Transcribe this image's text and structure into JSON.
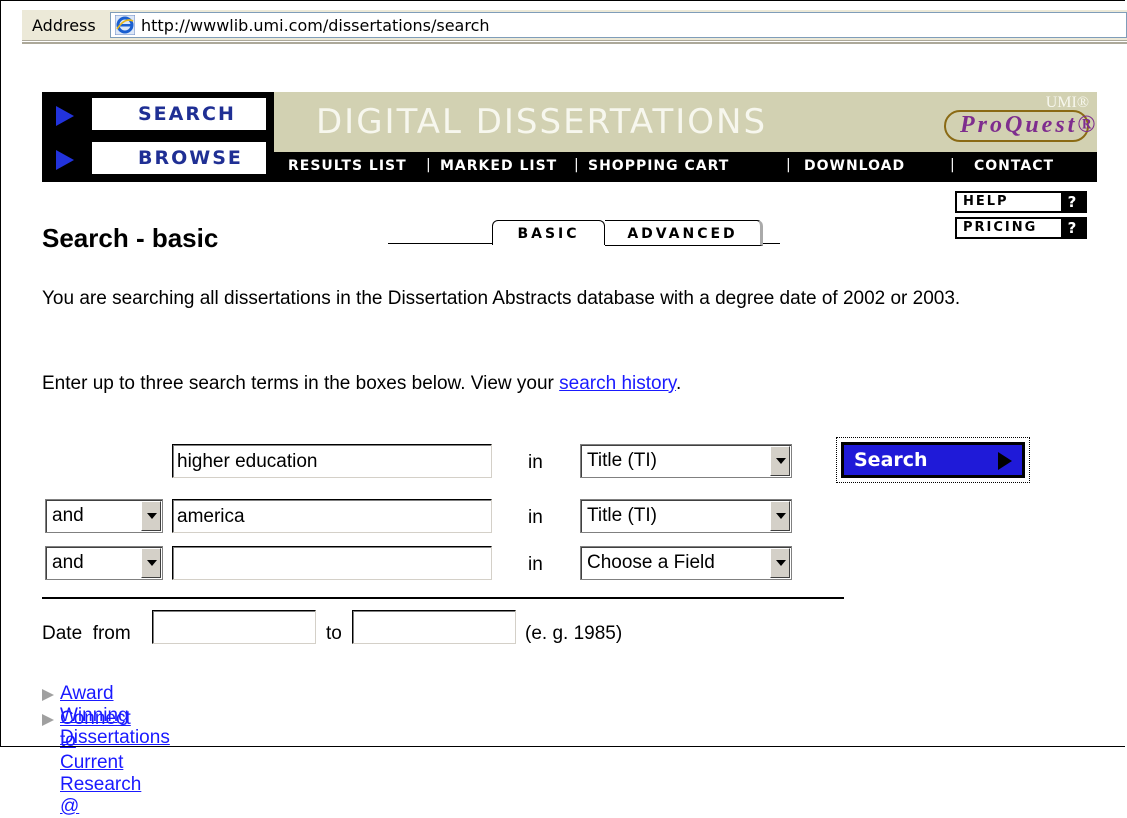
{
  "browser": {
    "address_label": "Address",
    "url": "http://wwwlib.umi.com/dissertations/search"
  },
  "banner": {
    "nav": [
      {
        "label": "SEARCH"
      },
      {
        "label": "BROWSE"
      }
    ],
    "title": "DIGITAL DISSERTATIONS",
    "logo_top": "UMI®",
    "logo_main": "ProQuest®",
    "menu": [
      "RESULTS LIST",
      "MARKED LIST",
      "SHOPPING CART",
      "DOWNLOAD",
      "CONTACT"
    ],
    "help_label": "HELP",
    "pricing_label": "PRICING",
    "question_mark": "?"
  },
  "page": {
    "title": "Search - basic",
    "tabs": [
      {
        "label": "BASIC",
        "active": true
      },
      {
        "label": "ADVANCED",
        "active": false
      }
    ],
    "intro": "You are searching all dissertations in the Dissertation Abstracts database with a degree date of 2002 or 2003.",
    "hint_prefix": "Enter up to three search terms in the boxes below. View your ",
    "hint_link": "search history",
    "hint_suffix": "."
  },
  "form": {
    "rows": [
      {
        "operator": "",
        "term": "higher education",
        "in_label": "in",
        "field": "Title (TI)"
      },
      {
        "operator": "and",
        "term": "america",
        "in_label": "in",
        "field": "Title (TI)"
      },
      {
        "operator": "and",
        "term": "",
        "in_label": "in",
        "field": "Choose a Field"
      }
    ],
    "search_button": "Search",
    "date_from_label": "Date  from",
    "date_to_label": "to",
    "date_from": "",
    "date_to": "",
    "date_example": "(e. g. 1985)"
  },
  "links": [
    "Award Winning Dissertations",
    "Connect to Current Research @"
  ],
  "colors": {
    "accent_blue": "#1f1ad8",
    "banner_tan": "#d2d1b2",
    "nav_text": "#1f2f94",
    "link": "#1a1aff"
  }
}
